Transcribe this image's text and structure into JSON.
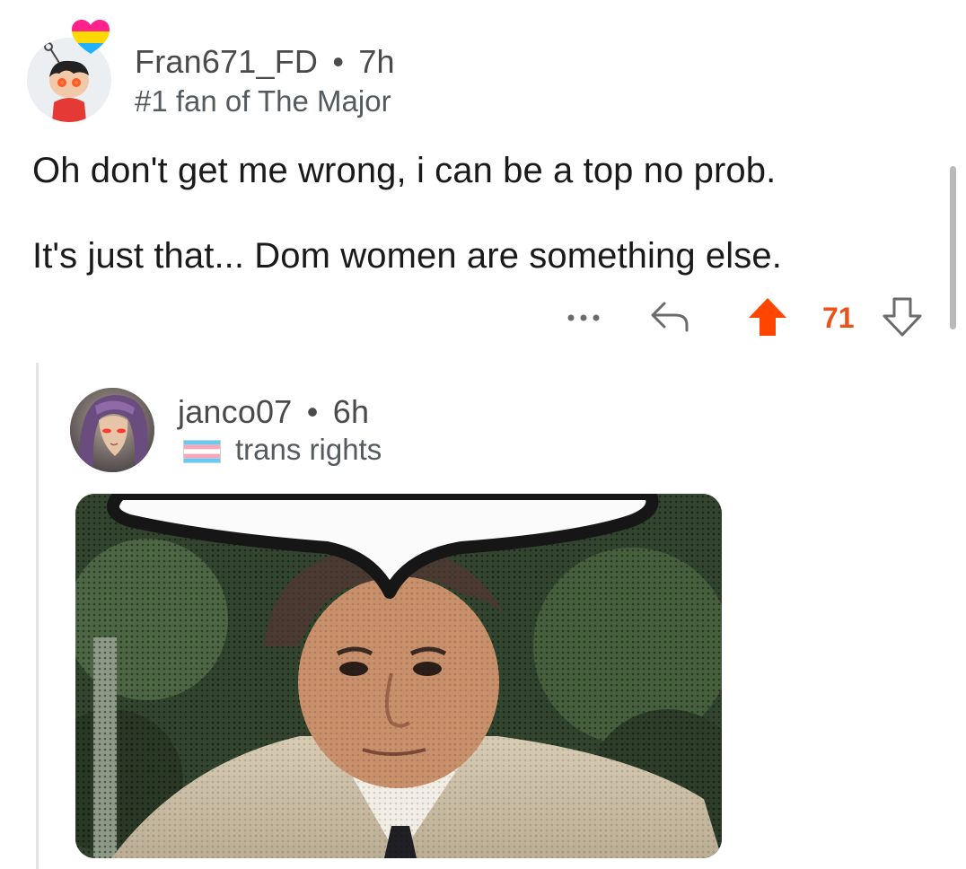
{
  "comment": {
    "username": "Fran671_FD",
    "separator": "•",
    "age": "7h",
    "flair": "#1 fan of The Major",
    "paragraphs": [
      "Oh don't get me wrong, i can be a top no prob.",
      "It's just that... Dom women are something else."
    ],
    "actions": {
      "more_icon": "more-dots-icon",
      "reply_icon": "reply-arrow-icon",
      "upvote_icon": "upvote-arrow-icon",
      "downvote_icon": "downvote-arrow-icon",
      "vote_count": "71",
      "upvoted": true
    }
  },
  "reply": {
    "username": "janco07",
    "separator": "•",
    "age": "6h",
    "flair_icon": "trans-flag-icon",
    "flair": "trans rights"
  },
  "colors": {
    "upvote": "#ff4500",
    "vote_count": "#e8541c",
    "meta_text": "#555a5f",
    "thread_line": "#e4e4e4"
  }
}
